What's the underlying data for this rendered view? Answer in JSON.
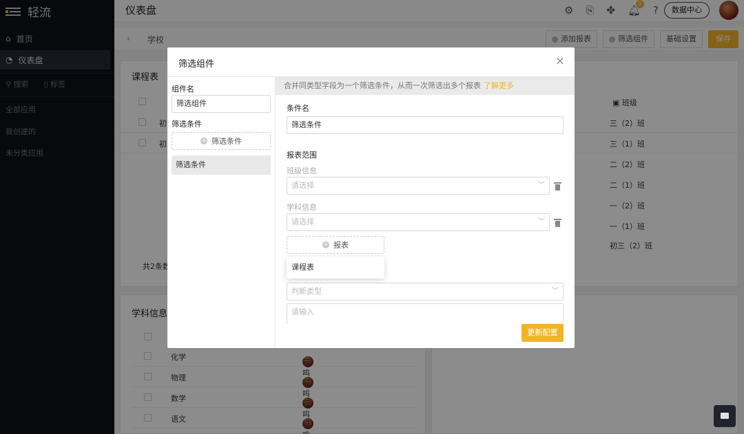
{
  "app": {
    "name": "轻流"
  },
  "sidebar": {
    "items": [
      {
        "label": "首页",
        "icon": "home-icon"
      },
      {
        "label": "仪表盘",
        "icon": "dashboard-icon",
        "active": true
      }
    ],
    "search_label": "搜索",
    "tag_label": "标签",
    "links": [
      "全部应用",
      "我创建的",
      "未分类应用"
    ]
  },
  "topbar": {
    "title": "仪表盘",
    "notification_count": "1",
    "data_center_label": "数据中心"
  },
  "subbar": {
    "breadcrumb": "学校",
    "add_report_label": "添加报表",
    "filter_component_label": "筛选组件",
    "basic_settings_label": "基础设置",
    "save_label": "保存"
  },
  "background": {
    "course_card_title": "课程表",
    "class_column_header": "班级",
    "course_rows": [
      {
        "col1": "初",
        "class": "三（2）班"
      },
      {
        "col1": "初",
        "class": "三（1）班"
      }
    ],
    "class_column_values": [
      "二（2）班",
      "二（1）班",
      "一（2）班",
      "一（1）班",
      "初三（2）班"
    ],
    "total_text": "共2条数",
    "subject_card_title": "学科信息",
    "subject_rows": [
      {
        "subject": "化学",
        "user": "喵呜"
      },
      {
        "subject": "物理",
        "user": "喵呜"
      },
      {
        "subject": "数学",
        "user": "喵呜"
      },
      {
        "subject": "语文",
        "user": "喵呜"
      }
    ]
  },
  "modal": {
    "title": "筛选组件",
    "close_symbol": "×",
    "left": {
      "component_name_label": "组件名",
      "component_name_value": "筛选组件",
      "conditions_label": "筛选条件",
      "add_condition_label": "筛选条件",
      "condition_item": "筛选条件"
    },
    "right": {
      "tip_text": "合并同类型字段为一个筛选条件，从而一次筛选出多个报表",
      "tip_link": "了解更多",
      "condition_name_label": "条件名",
      "condition_name_value": "筛选条件",
      "report_scope_label": "报表范围",
      "class_info_label": "班级信息",
      "class_select_placeholder": "请选择",
      "subject_info_label": "学科信息",
      "subject_select_placeholder": "请选择",
      "add_report_label": "报表",
      "dropdown_option": "课程表",
      "judge_type_placeholder": "判断类型",
      "value_input_placeholder": "请输入",
      "update_button_label": "更新配置"
    }
  },
  "colors": {
    "accent": "#f0b429",
    "sidebar_bg": "#0f1118"
  }
}
